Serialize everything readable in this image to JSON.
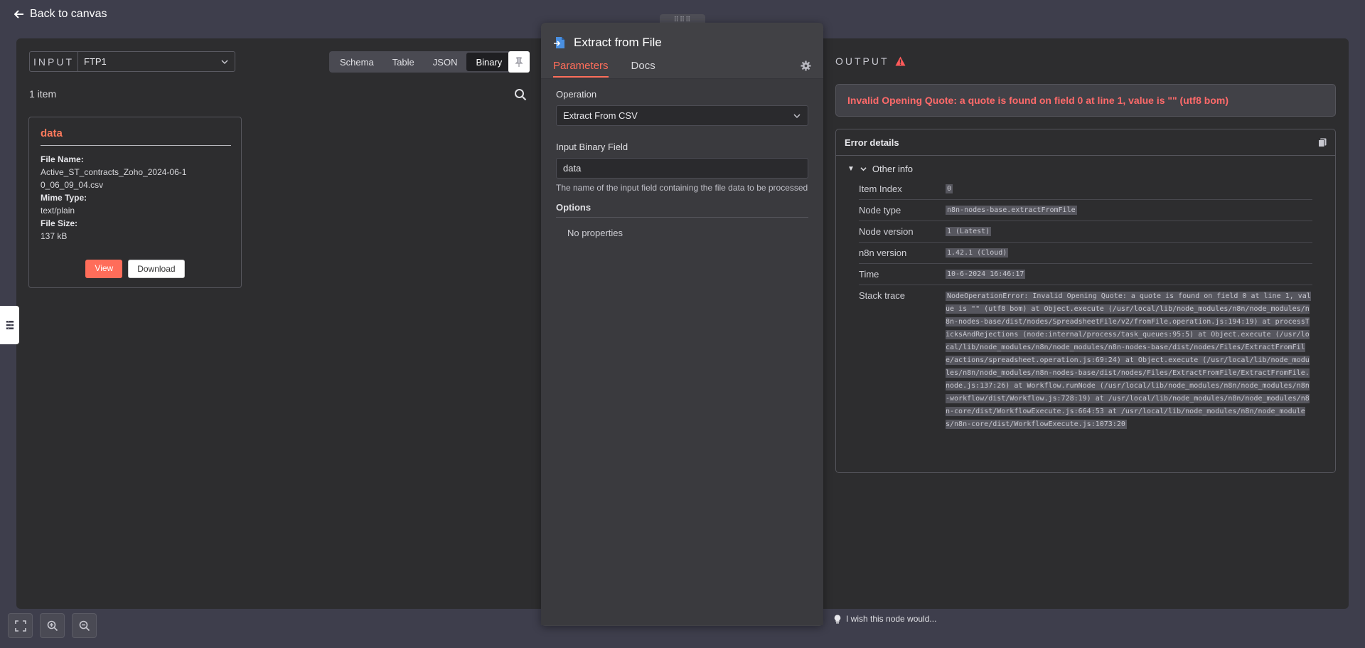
{
  "header": {
    "back_label": "Back to canvas"
  },
  "input_panel": {
    "label": "INPUT",
    "node": "FTP1",
    "view_tabs": [
      "Schema",
      "Table",
      "JSON",
      "Binary"
    ],
    "active_tab": "Binary",
    "items_count": "1 item",
    "card": {
      "title": "data",
      "file_name_label": "File Name:",
      "file_name": "Active_ST_contracts_Zoho_2024-06-10_06_09_04.csv",
      "mime_label": "Mime Type:",
      "mime": "text/plain",
      "size_label": "File Size:",
      "size": "137 kB",
      "view_label": "View",
      "download_label": "Download"
    }
  },
  "node_panel": {
    "title": "Extract from File",
    "tabs": [
      "Parameters",
      "Docs"
    ],
    "operation_label": "Operation",
    "operation_value": "Extract From CSV",
    "binary_field_label": "Input Binary Field",
    "binary_field_value": "data",
    "binary_field_hint": "The name of the input field containing the file data to be processed",
    "options_label": "Options",
    "no_properties": "No properties"
  },
  "output_panel": {
    "label": "OUTPUT",
    "error_message": "Invalid Opening Quote: a quote is found on field 0 at line 1, value is \"\" (utf8 bom)",
    "details_title": "Error details",
    "other_info": "Other info",
    "rows": [
      {
        "key": "Item Index",
        "value": "0"
      },
      {
        "key": "Node type",
        "value": "n8n-nodes-base.extractFromFile"
      },
      {
        "key": "Node version",
        "value": "1 (Latest)"
      },
      {
        "key": "n8n version",
        "value": "1.42.1 (Cloud)"
      },
      {
        "key": "Time",
        "value": "10-6-2024 16:46:17"
      },
      {
        "key": "Stack trace",
        "value": "NodeOperationError: Invalid Opening Quote: a quote is found on field 0 at line 1, value is \"\" (utf8 bom) at Object.execute (/usr/local/lib/node_modules/n8n/node_modules/n8n-nodes-base/dist/nodes/SpreadsheetFile/v2/fromFile.operation.js:194:19) at processTicksAndRejections (node:internal/process/task_queues:95:5) at Object.execute (/usr/local/lib/node_modules/n8n/node_modules/n8n-nodes-base/dist/nodes/Files/ExtractFromFile/actions/spreadsheet.operation.js:69:24) at Object.execute (/usr/local/lib/node_modules/n8n/node_modules/n8n-nodes-base/dist/nodes/Files/ExtractFromFile/ExtractFromFile.node.js:137:26) at Workflow.runNode (/usr/local/lib/node_modules/n8n/node_modules/n8n-workflow/dist/Workflow.js:728:19) at /usr/local/lib/node_modules/n8n/node_modules/n8n-core/dist/WorkflowExecute.js:664:53 at /usr/local/lib/node_modules/n8n/node_modules/n8n-core/dist/WorkflowExecute.js:1073:20"
      }
    ]
  },
  "footer": {
    "wish_label": "I wish this node would..."
  },
  "colors": {
    "accent": "#ff6d5a",
    "error": "#ff6a6a"
  }
}
